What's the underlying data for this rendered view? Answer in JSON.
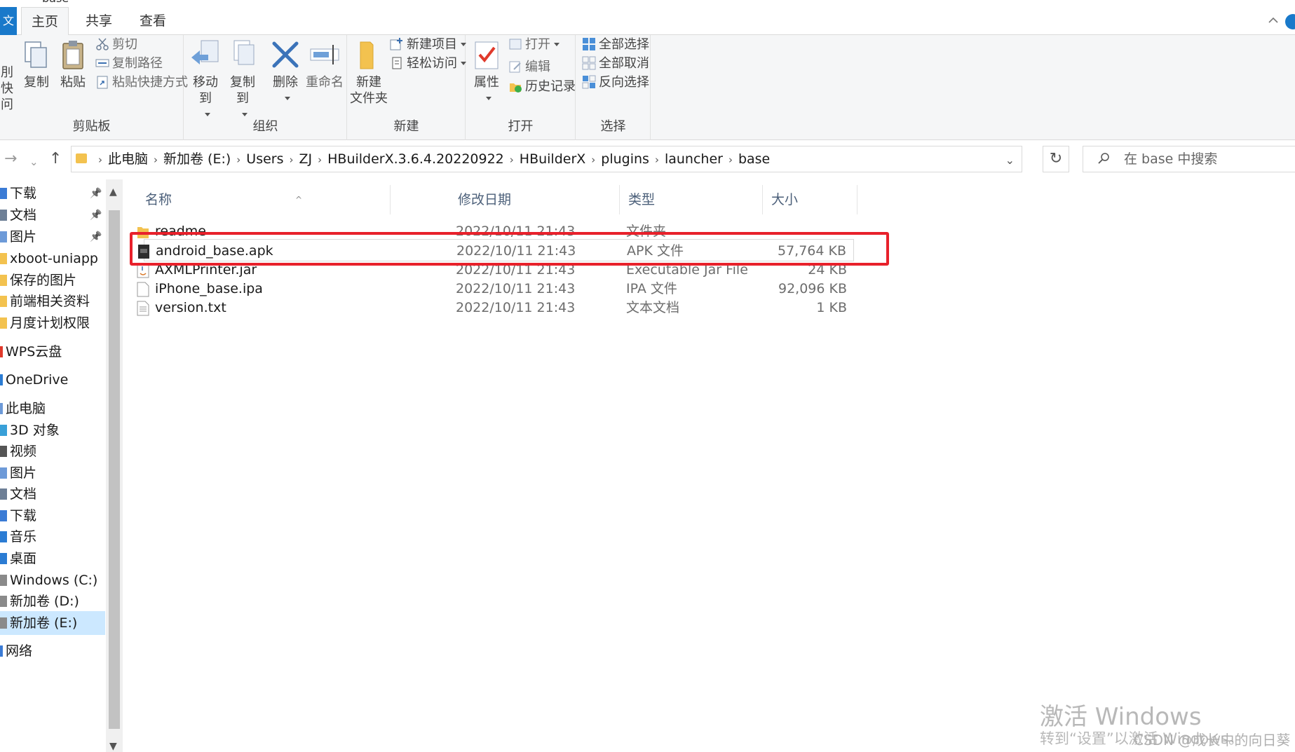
{
  "window": {
    "title": "base"
  },
  "tabs": {
    "file": "文",
    "home": "主页",
    "share": "共享",
    "view": "查看"
  },
  "ribbon": {
    "clipboard": {
      "label": "剪贴板",
      "pin_quick_l1": "刖快",
      "pin_quick_l2": "问",
      "copy": "复制",
      "paste": "粘贴",
      "cut": "剪切",
      "copy_path": "复制路径",
      "paste_shortcut": "粘贴快捷方式"
    },
    "organize": {
      "label": "组织",
      "move_to": "移动到",
      "copy_to": "复制到",
      "delete": "删除",
      "rename": "重命名"
    },
    "new": {
      "label": "新建",
      "new_folder_l1": "新建",
      "new_folder_l2": "文件夹",
      "new_item": "新建项目",
      "easy_access": "轻松访问"
    },
    "open": {
      "label": "打开",
      "properties": "属性",
      "open": "打开",
      "edit": "编辑",
      "history": "历史记录"
    },
    "select": {
      "label": "选择",
      "select_all": "全部选择",
      "select_none": "全部取消",
      "invert": "反向选择"
    }
  },
  "address": {
    "crumbs": [
      "此电脑",
      "新加卷 (E:)",
      "Users",
      "ZJ",
      "HBuilderX.3.6.4.20220922",
      "HBuilderX",
      "plugins",
      "launcher",
      "base"
    ],
    "search_placeholder": "在 base 中搜索"
  },
  "navpane": {
    "items": [
      "下载",
      "文档",
      "图片",
      "xboot-uniapp",
      "保存的图片",
      "前端相关资料",
      "月度计划权限",
      "WPS云盘",
      "OneDrive",
      "此电脑",
      "3D 对象",
      "视频",
      "图片",
      "文档",
      "下载",
      "音乐",
      "桌面",
      "Windows (C:)",
      "新加卷 (D:)",
      "新加卷 (E:)",
      "网络"
    ]
  },
  "columns": {
    "name": "名称",
    "date": "修改日期",
    "type": "类型",
    "size": "大小"
  },
  "files": [
    {
      "name": "readme",
      "date": "2022/10/11 21:43",
      "type": "文件夹",
      "size": ""
    },
    {
      "name": "android_base.apk",
      "date": "2022/10/11 21:43",
      "type": "APK 文件",
      "size": "57,764 KB"
    },
    {
      "name": "AXMLPrinter.jar",
      "date": "2022/10/11 21:43",
      "type": "Executable Jar File",
      "size": "24 KB"
    },
    {
      "name": "iPhone_base.ipa",
      "date": "2022/10/11 21:43",
      "type": "IPA 文件",
      "size": "92,096 KB"
    },
    {
      "name": "version.txt",
      "date": "2022/10/11 21:43",
      "type": "文本文档",
      "size": "1 KB"
    }
  ],
  "watermark": {
    "line1": "激活 Windows",
    "line2": "转到“设置”以激活 Windows。",
    "credit": "CSDN @成长中的向日葵"
  },
  "colors": {
    "accent": "#1979ca",
    "highlight": "#e8212b",
    "folder": "#f3c24f"
  }
}
